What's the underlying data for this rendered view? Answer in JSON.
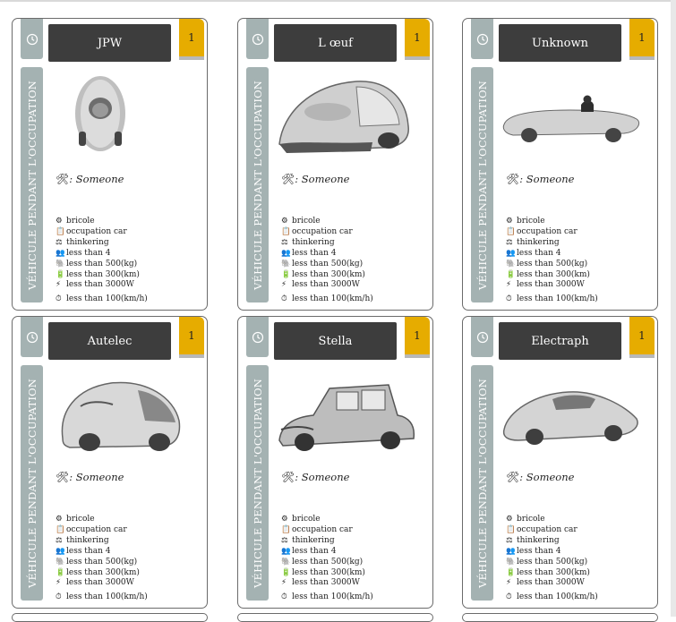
{
  "side_label": "VÉHICULE PENDANT L'OCCUPATION",
  "icons": {
    "corner": "clock-icon",
    "builder": "tools-icon",
    "stats": [
      "gear-icon",
      "clipboard-icon",
      "scales-icon",
      "people-icon",
      "elephant-icon",
      "battery-icon",
      "lightning-icon",
      "stopwatch-icon"
    ]
  },
  "colors": {
    "side": "#a4b2b2",
    "title_bg": "#3d3d3d",
    "number_bg": "#e6ac00"
  },
  "cards": [
    {
      "title": "JPW",
      "number": "1",
      "builder": "Someone",
      "stats": [
        "bricole",
        "occupation car",
        "thinkering",
        "less than 4",
        "less than 500(kg)",
        "less than 300(km)",
        "less than 3000W",
        "less than 100(km/h)"
      ]
    },
    {
      "title": "L œuf",
      "number": "1",
      "builder": "Someone",
      "stats": [
        "bricole",
        "occupation car",
        "thinkering",
        "less than 4",
        "less than 500(kg)",
        "less than 300(km)",
        "less than 3000W",
        "less than 100(km/h)"
      ]
    },
    {
      "title": "Unknown",
      "number": "1",
      "builder": "Someone",
      "stats": [
        "bricole",
        "occupation car",
        "thinkering",
        "less than 4",
        "less than 500(kg)",
        "less than 300(km)",
        "less than 3000W",
        "less than 100(km/h)"
      ]
    },
    {
      "title": "Autelec",
      "number": "1",
      "builder": "Someone",
      "stats": [
        "bricole",
        "occupation car",
        "thinkering",
        "less than 4",
        "less than 500(kg)",
        "less than 300(km)",
        "less than 3000W",
        "less than 100(km/h)"
      ]
    },
    {
      "title": "Stella",
      "number": "1",
      "builder": "Someone",
      "stats": [
        "bricole",
        "occupation car",
        "thinkering",
        "less than 4",
        "less than 500(kg)",
        "less than 300(km)",
        "less than 3000W",
        "less than 100(km/h)"
      ]
    },
    {
      "title": "Electraph",
      "number": "1",
      "builder": "Someone",
      "stats": [
        "bricole",
        "occupation car",
        "thinkering",
        "less than 4",
        "less than 500(kg)",
        "less than 300(km)",
        "less than 3000W",
        "less than 100(km/h)"
      ]
    }
  ]
}
